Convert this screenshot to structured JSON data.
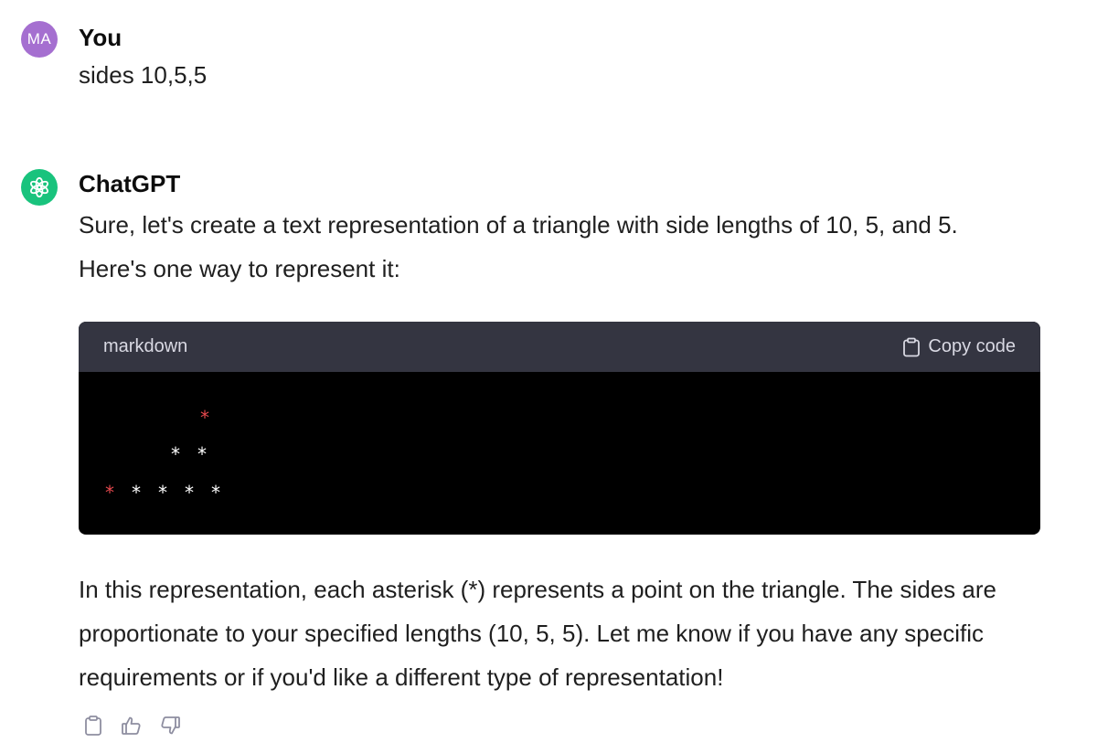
{
  "user_message": {
    "avatar_initials": "MA",
    "author": "You",
    "text": "sides 10,5,5"
  },
  "assistant_message": {
    "author": "ChatGPT",
    "intro_line1": "Sure, let's create a text representation of a triangle with side lengths of 10, 5, and 5.",
    "intro_line2": "Here's one way to represent it:",
    "code_block": {
      "language": "markdown",
      "copy_label": "Copy code",
      "asterisk": "*"
    },
    "outro_line1": "In this representation, each asterisk (*) represents a point on the triangle. The sides are",
    "outro_line2": "proportionate to your specified lengths (10, 5, 5). Let me know if you have any specific",
    "outro_line3": "requirements or if you'd like a different type of representation!"
  },
  "colors": {
    "user_avatar": "#a56fd0",
    "assistant_avatar": "#19c37d",
    "code_header_bg": "#343541",
    "code_bg": "#000000",
    "highlight_red": "#e5484d"
  },
  "icons": {
    "assistant_avatar": "openai-logo-icon",
    "copy_code": "clipboard-icon",
    "copy_message": "clipboard-icon",
    "like": "thumbs-up-icon",
    "dislike": "thumbs-down-icon"
  }
}
